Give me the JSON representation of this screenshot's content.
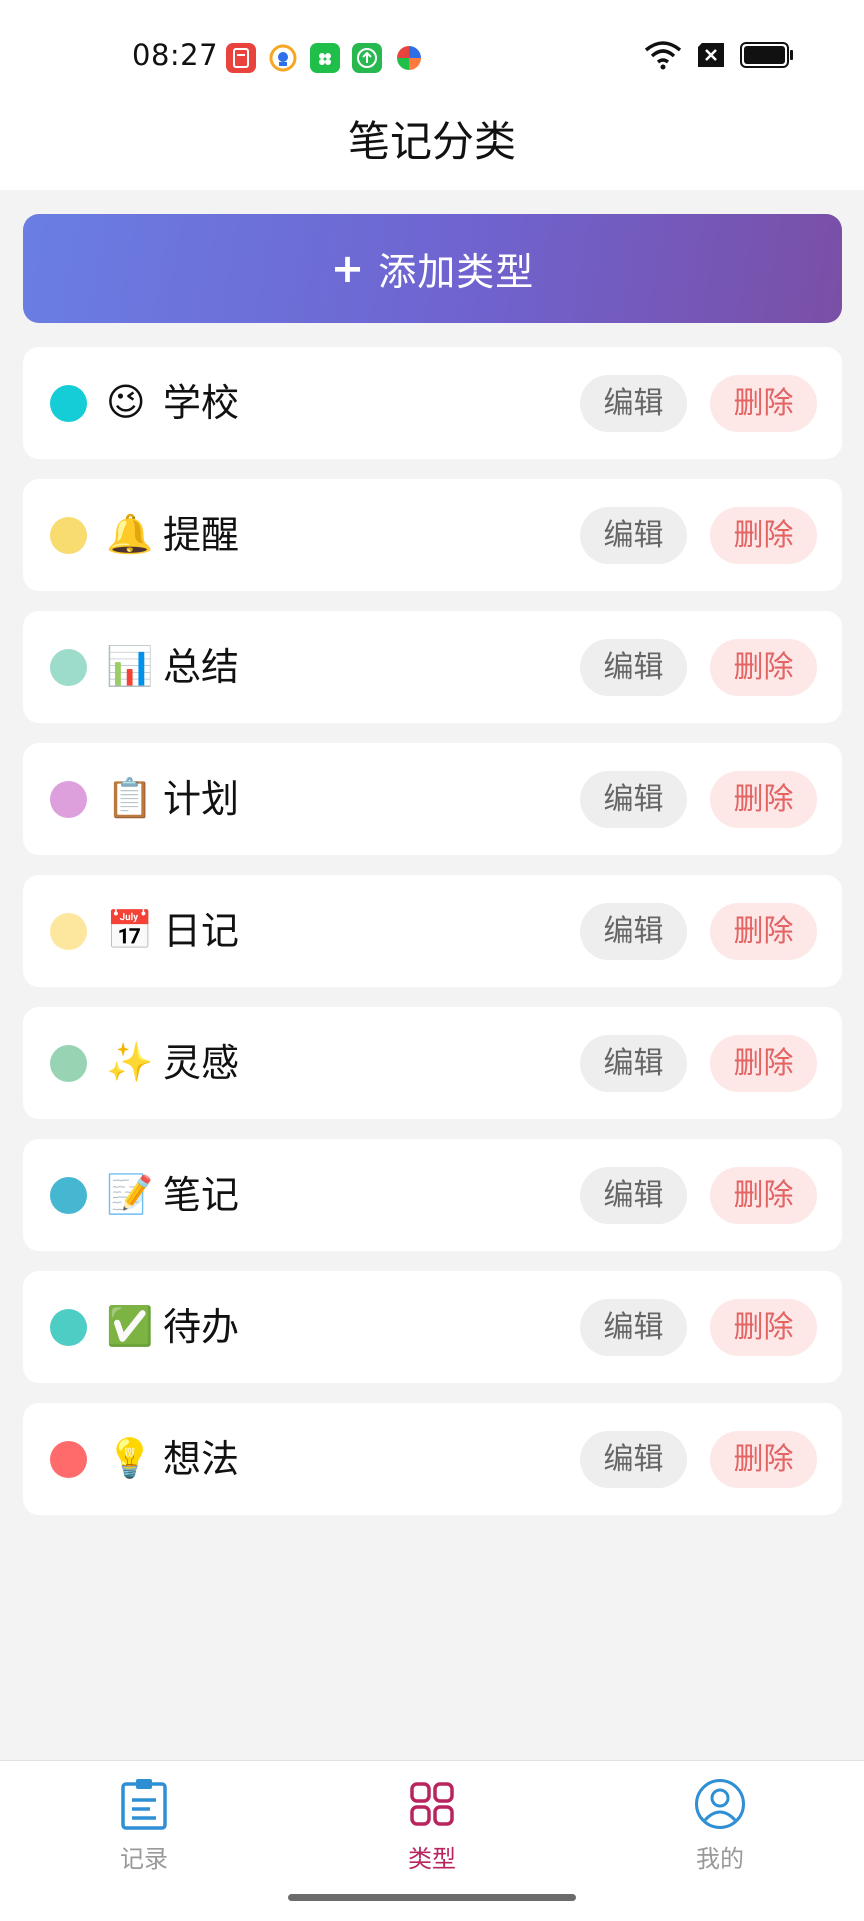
{
  "status_bar": {
    "time": "08:27",
    "notifications": [
      {
        "icon": "red-app-icon",
        "color": "#e8433d"
      },
      {
        "icon": "blue-circle-app-icon",
        "color": "#2c6fe8"
      },
      {
        "icon": "green-shop-app-icon",
        "color": "#1fbf4a"
      },
      {
        "icon": "green-upload-app-icon",
        "color": "#27b850"
      },
      {
        "icon": "colorful-pinwheel-icon",
        "color": "#ff7a3c"
      }
    ],
    "right_icons": [
      "wifi-icon",
      "sim-x-icon",
      "battery-icon"
    ]
  },
  "header": {
    "title": "笔记分类"
  },
  "add_button": {
    "icon": "plus-icon",
    "label": "添加类型"
  },
  "categories": [
    {
      "name": "学校",
      "emoji": "😉",
      "color": "#14cdd6"
    },
    {
      "name": "提醒",
      "emoji": "🔔",
      "color": "#f8dc6f"
    },
    {
      "name": "总结",
      "emoji": "📊",
      "color": "#9ddbcb"
    },
    {
      "name": "计划",
      "emoji": "📋",
      "color": "#dda0dd"
    },
    {
      "name": "日记",
      "emoji": "📅",
      "color": "#fde79e"
    },
    {
      "name": "灵感",
      "emoji": "✨",
      "color": "#98d3b4"
    },
    {
      "name": "笔记",
      "emoji": "📝",
      "color": "#45b7d1"
    },
    {
      "name": "待办",
      "emoji": "✅",
      "color": "#4ecdc4"
    },
    {
      "name": "想法",
      "emoji": "💡",
      "color": "#ff6b6b"
    }
  ],
  "actions": {
    "edit": "编辑",
    "delete": "删除"
  },
  "accent_colors": {
    "gradient_start": "#6a7ee3",
    "gradient_end": "#7a4fa6",
    "delete_text": "#e46464",
    "active_tab": "#b8245e"
  },
  "tabs": [
    {
      "label": "记录",
      "icon": "clipboard-icon",
      "active": false
    },
    {
      "label": "类型",
      "icon": "grid-icon",
      "active": true
    },
    {
      "label": "我的",
      "icon": "user-icon",
      "active": false
    }
  ]
}
